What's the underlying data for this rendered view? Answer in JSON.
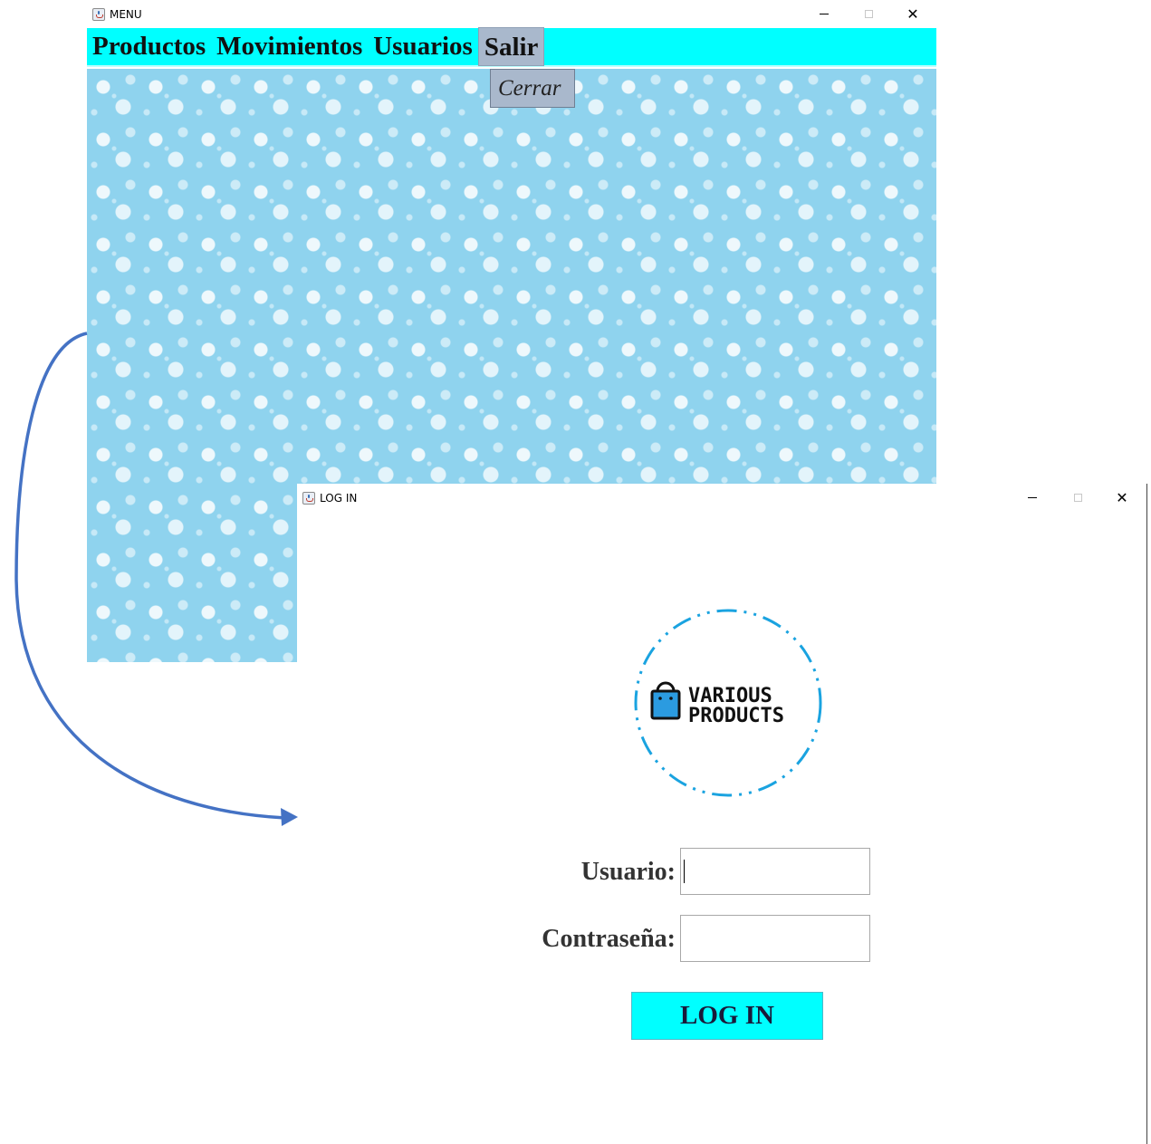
{
  "menu_window": {
    "title": "MENU",
    "menu_items": [
      "Productos",
      "Movimientos",
      "Usuarios",
      "Salir"
    ],
    "active_menu": "Salir",
    "dropdown_item": "Cerrar"
  },
  "login_window": {
    "title": "LOG IN",
    "logo_line1": "VARIOUS",
    "logo_line2": "PRODUCTS",
    "usuario_label": "Usuario:",
    "usuario_value": "",
    "contrasena_label": "Contraseña:",
    "contrasena_value": "",
    "login_button": "LOG IN"
  },
  "colors": {
    "menu_bar": "#00ffff",
    "menu_active": "#a9b8cc",
    "pattern_bg": "#8fd3ee",
    "button_bg": "#00ffff",
    "logo_accent": "#1aa3e0",
    "arrow": "#4472c4"
  },
  "icons": {
    "window_icon": "java-cup-icon",
    "logo_icon": "shopping-bag-icon"
  }
}
